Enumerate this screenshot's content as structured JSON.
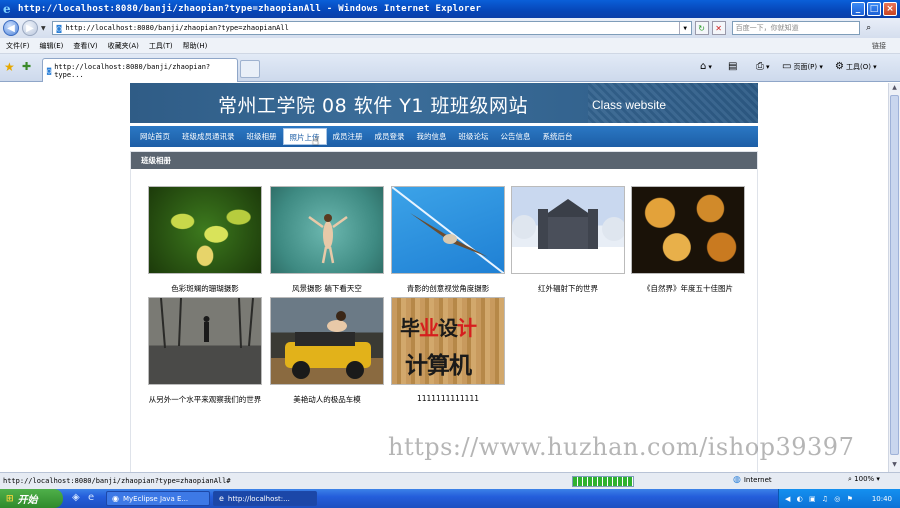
{
  "window": {
    "title": "http://localhost:8080/banji/zhaopian?type=zhaopianAll - Windows Internet Explorer",
    "minimize": "_",
    "maximize": "□",
    "close": "×"
  },
  "address_bar": {
    "url": "http://localhost:8080/banji/zhaopian?type=zhaopianAll",
    "search_placeholder": "百度一下，你就知道"
  },
  "menu": {
    "items": [
      "文件(F)",
      "编辑(E)",
      "查看(V)",
      "收藏夹(A)",
      "工具(T)",
      "帮助(H)"
    ],
    "links_label": "链接"
  },
  "tab": {
    "title": "http://localhost:8080/banji/zhaopian?type..."
  },
  "commands": {
    "page": "页面(P)",
    "tools": "工具(O)"
  },
  "site": {
    "title": "常州工学院  08 软件  Y1 班班级网站",
    "subtitle": "Class website",
    "nav": [
      "网站首页",
      "班级成员通讯录",
      "班级相册",
      "照片上传",
      "成员注册",
      "成员登录",
      "我的信息",
      "班级论坛",
      "公告信息",
      "系统后台"
    ],
    "active_nav_index": 3,
    "section_title": "班级相册",
    "photos": [
      {
        "caption": "色彩斑斓的珊瑚摄影"
      },
      {
        "caption": "风景摄影 躺下看天空"
      },
      {
        "caption": "青影的创意视觉角度摄影"
      },
      {
        "caption": "红外辐射下的世界"
      },
      {
        "caption": "《自然界》年度五十佳图片"
      },
      {
        "caption": "从另外一个水平来观察我们的世界"
      },
      {
        "caption": "美艳动人的极品车模"
      },
      {
        "caption": "1111111111111"
      }
    ],
    "design_image_text": {
      "line1_a": "毕",
      "line1_b": "业",
      "line1_c": "设",
      "line1_d": "计",
      "line2": "计算机"
    }
  },
  "watermark": "https://www.huzhan.com/ishop39397",
  "status": {
    "text": "http://localhost:8080/banji/zhaopian?type=zhaopianAll#",
    "zone": "Internet",
    "zoom": "100%",
    "progress_percent": 100
  },
  "taskbar": {
    "start": "开始",
    "items": [
      {
        "label": "MyEclipse Java E..."
      },
      {
        "label": "http://localhost:..."
      }
    ],
    "clock": "10:40"
  }
}
